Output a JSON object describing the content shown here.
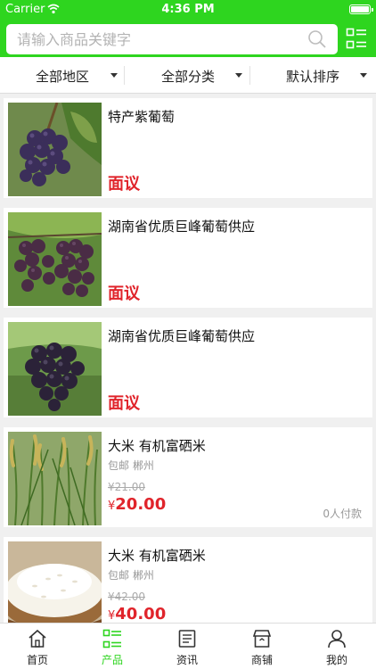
{
  "status": {
    "carrier": "Carrier",
    "time": "4:36 PM"
  },
  "search": {
    "placeholder": "请输入商品关键字"
  },
  "filters": [
    {
      "label": "全部地区"
    },
    {
      "label": "全部分类"
    },
    {
      "label": "默认排序"
    }
  ],
  "products": [
    {
      "title": "特产紫葡萄",
      "price": "面议"
    },
    {
      "title": "湖南省优质巨峰葡萄供应",
      "price": "面议"
    },
    {
      "title": "湖南省优质巨峰葡萄供应",
      "price": "面议"
    },
    {
      "title": "大米 有机富硒米",
      "tags": "包邮 郴州",
      "old_price": "¥21.00",
      "currency": "¥",
      "price": "20.00",
      "sold": "0人付款"
    },
    {
      "title": "大米 有机富硒米",
      "tags": "包邮 郴州",
      "old_price": "¥42.00",
      "currency": "¥",
      "price": "40.00"
    }
  ],
  "tabs": [
    {
      "label": "首页",
      "icon": "home-icon"
    },
    {
      "label": "产品",
      "icon": "product-list-icon",
      "active": true
    },
    {
      "label": "资讯",
      "icon": "news-icon"
    },
    {
      "label": "商铺",
      "icon": "shop-icon"
    },
    {
      "label": "我的",
      "icon": "person-icon"
    }
  ],
  "colors": {
    "brand": "#2ed51f",
    "price": "#e0242b"
  }
}
